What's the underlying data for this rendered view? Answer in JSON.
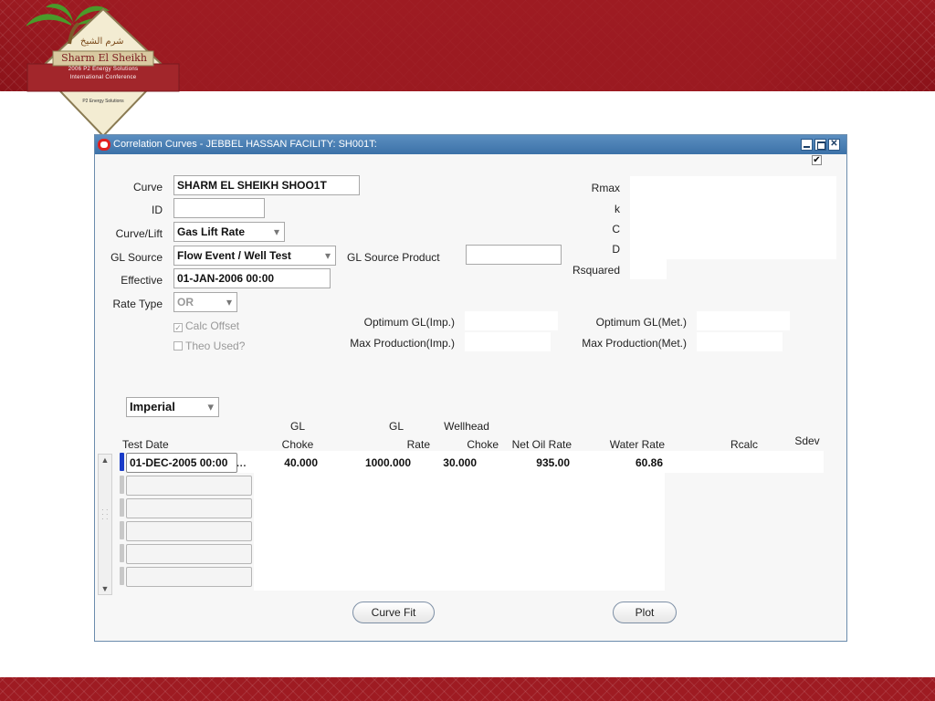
{
  "logo": {
    "arabic_text": "شرم الشيخ",
    "city": "Sharm El Sheikh",
    "line1": "2006 P2 Energy Solutions",
    "line2": "International Conference",
    "company": "P2 Energy Solutions"
  },
  "window": {
    "title": "Correlation Curves - JEBBEL HASSAN FACILITY: SH001T:",
    "top_checkbox": "✔"
  },
  "form": {
    "curve_label": "Curve",
    "curve_value": "SHARM EL SHEIKH SHOO1T",
    "id_label": "ID",
    "id_value": "",
    "curve_lift_label": "Curve/Lift",
    "curve_lift_value": "Gas Lift Rate",
    "gl_source_label": "GL Source",
    "gl_source_value": "Flow Event / Well Test",
    "gl_source_product_label": "GL Source Product",
    "gl_source_product_value": "",
    "effective_label": "Effective",
    "effective_value": "01-JAN-2006 00:00",
    "rate_type_label": "Rate Type",
    "rate_type_value": "OR",
    "calc_offset_label": "Calc Offset",
    "calc_offset_checked": true,
    "theo_used_label": "Theo Used?",
    "theo_used_checked": false,
    "rmax_label": "Rmax",
    "k_label": "k",
    "c_label": "C",
    "d_label": "D",
    "rsquared_label": "Rsquared",
    "opt_gl_imp_label": "Optimum GL(Imp.)",
    "max_prod_imp_label": "Max Production(Imp.)",
    "opt_gl_met_label": "Optimum GL(Met.)",
    "max_prod_met_label": "Max Production(Met.)",
    "units_value": "Imperial"
  },
  "table": {
    "headers": {
      "test_date": "Test Date",
      "gl_choke_1": "GL",
      "gl_choke_2": "Choke",
      "gl_rate_1": "GL",
      "gl_rate_2": "Rate",
      "wellhead_1": "Wellhead",
      "wellhead_2": "Choke",
      "net_oil": "Net Oil Rate",
      "water_rate": "Water Rate",
      "rcalc": "Rcalc",
      "sdev": "Sdev"
    },
    "rows": [
      {
        "test_date": "01-DEC-2005 00:00",
        "gl_choke": "40.000",
        "gl_rate": "1000.000",
        "wellhead_choke": "30.000",
        "net_oil": "935.00",
        "water_rate": "60.86",
        "rcalc": "",
        "sdev": ""
      }
    ],
    "row_dots": "···"
  },
  "buttons": {
    "curve_fit": "Curve Fit",
    "plot": "Plot"
  }
}
